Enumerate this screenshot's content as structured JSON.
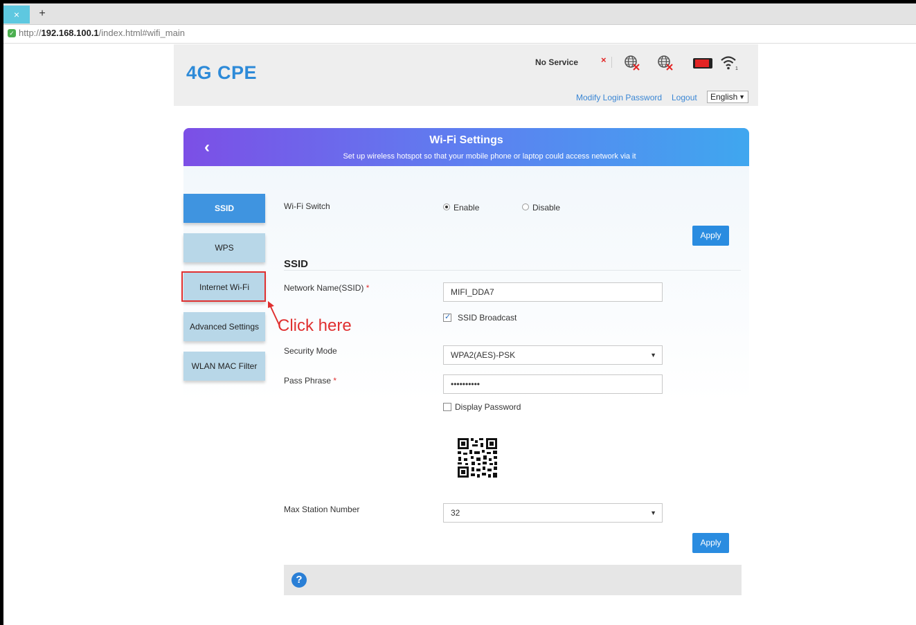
{
  "browser": {
    "url_scheme": "http://",
    "url_host": "192.168.100.1",
    "url_path": "/index.html#wifi_main",
    "tab_close_glyph": "×",
    "new_tab_glyph": "+"
  },
  "header": {
    "brand": "4G CPE",
    "status_text": "No Service",
    "signal_status_glyph": "×",
    "icons": [
      "network-disconnected-icon",
      "internet-disconnected-icon",
      "battery-icon",
      "wifi-icon"
    ],
    "modify_password_label": "Modify Login Password",
    "logout_label": "Logout",
    "language_value": "English",
    "language_caret": "▼"
  },
  "banner": {
    "back_glyph": "‹",
    "title": "Wi-Fi Settings",
    "subtitle": "Set up wireless hotspot so that your mobile phone or laptop could access network via it"
  },
  "sidebar": {
    "items": [
      {
        "label": "SSID",
        "active": true
      },
      {
        "label": "WPS",
        "active": false
      },
      {
        "label": "Internet Wi-Fi",
        "active": false
      },
      {
        "label": "Advanced Settings",
        "active": false
      },
      {
        "label": "WLAN MAC Filter",
        "active": false
      }
    ]
  },
  "annotation": {
    "text": "Click here"
  },
  "form": {
    "wifi_switch_label": "Wi-Fi Switch",
    "enable_label": "Enable",
    "disable_label": "Disable",
    "wifi_switch_value": "Enable",
    "apply_label": "Apply",
    "section_title": "SSID",
    "network_name_label": "Network Name(SSID)",
    "required_mark": "*",
    "network_name_value": "MIFI_DDA7",
    "ssid_broadcast_label": "SSID Broadcast",
    "ssid_broadcast_checked": true,
    "security_mode_label": "Security Mode",
    "security_mode_value": "WPA2(AES)-PSK",
    "select_caret": "▼",
    "pass_phrase_label": "Pass Phrase",
    "pass_phrase_value": "••••••••••",
    "display_password_label": "Display Password",
    "display_password_checked": false,
    "max_station_label": "Max Station Number",
    "max_station_value": "32"
  },
  "help": {
    "icon_glyph": "?"
  },
  "colors": {
    "brand_blue": "#2d8ad8",
    "active_tab": "#3f94e0",
    "inactive_tab": "#b8d7e8",
    "apply_button": "#2a8ce0",
    "annotation_red": "#e03030"
  }
}
